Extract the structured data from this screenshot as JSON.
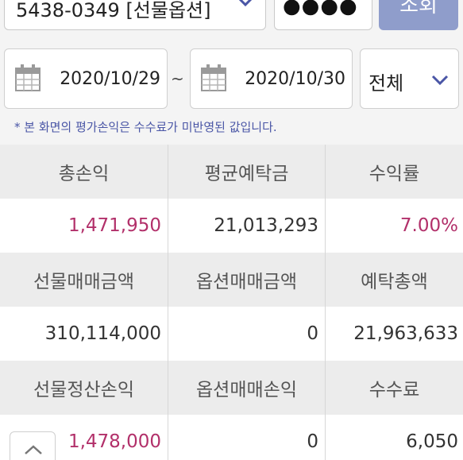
{
  "account": {
    "text": "5438-0349 [선물옵션]",
    "password_masked": "●●●●",
    "inquiry_label": "조회"
  },
  "period": {
    "start_date": "2020/10/29",
    "separator": "~",
    "end_date": "2020/10/30",
    "type_value": "전체"
  },
  "notice": "* 본 화면의 평가손익은 수수료가 미반영된 값입니다.",
  "summary": {
    "rows": [
      {
        "headers": [
          "총손익",
          "평균예탁금",
          "수익률"
        ],
        "values": [
          "1,471,950",
          "21,013,293",
          "7.00%"
        ]
      },
      {
        "headers": [
          "선물매매금액",
          "옵션매매금액",
          "예탁총액"
        ],
        "values": [
          "310,114,000",
          "0",
          "21,963,633"
        ]
      },
      {
        "headers": [
          "선물정산손익",
          "옵션매매손익",
          "수수료"
        ],
        "values": [
          "1,478,000",
          "0",
          "6,050"
        ]
      }
    ]
  },
  "icons": {
    "account_dropdown": "chevron-down-icon",
    "calendar": "calendar-icon",
    "type_dropdown": "chevron-down-icon",
    "scroll_top": "chevron-up-icon"
  },
  "colors": {
    "accent": "#4a56a6",
    "positive": "#b2306a",
    "button": "#8f9dcb"
  }
}
